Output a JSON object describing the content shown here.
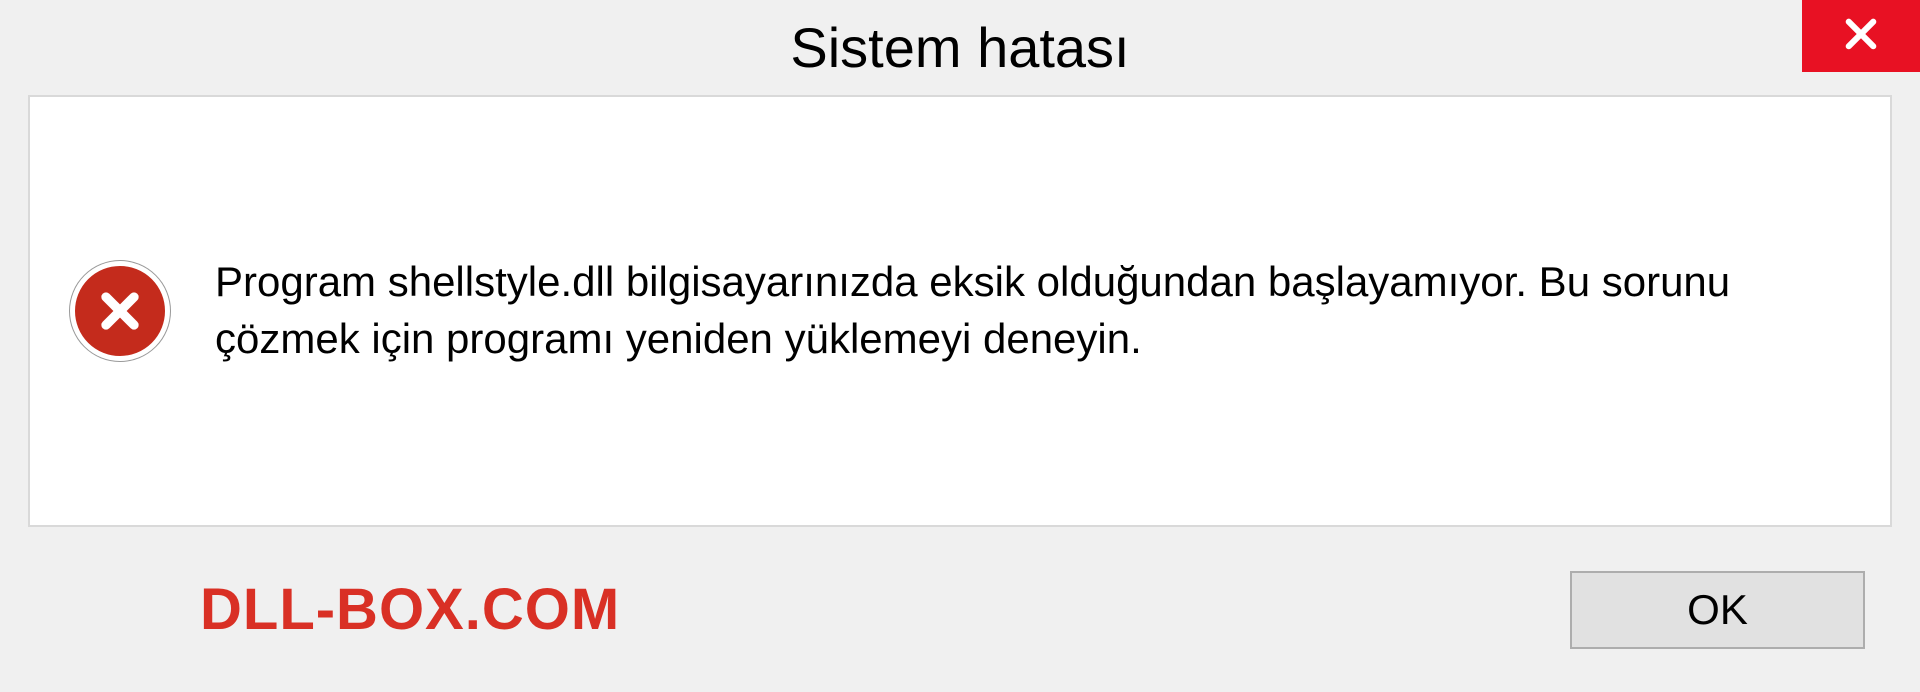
{
  "dialog": {
    "title": "Sistem hatası",
    "message": "Program shellstyle.dll bilgisayarınızda eksik olduğundan başlayamıyor. Bu sorunu çözmek için programı yeniden yüklemeyi deneyin.",
    "ok_label": "OK"
  },
  "watermark": "DLL-BOX.COM"
}
